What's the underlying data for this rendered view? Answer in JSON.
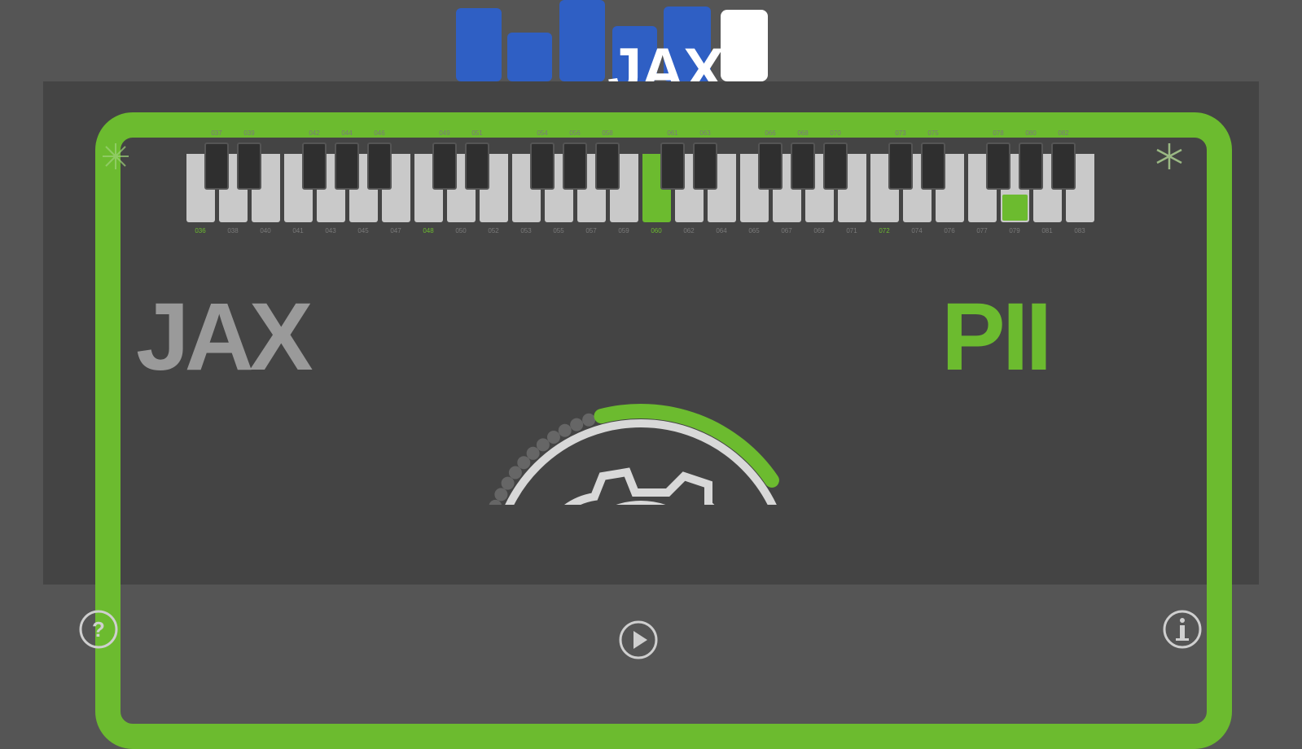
{
  "app": {
    "logo_text": "JAX",
    "brand_left": "JAX",
    "brand_right": "PII",
    "accent": "#6cbb2f",
    "logo_blue": "#2f5fc4"
  },
  "keyboard": {
    "white_labels": [
      "036",
      "038",
      "040",
      "041",
      "043",
      "045",
      "047",
      "048",
      "050",
      "052",
      "053",
      "055",
      "057",
      "059",
      "060",
      "062",
      "064",
      "065",
      "067",
      "069",
      "071",
      "072",
      "074",
      "076",
      "077",
      "079",
      "081",
      "083"
    ],
    "black_labels_top": [
      "037",
      "039",
      "042",
      "044",
      "046",
      "049",
      "051",
      "054",
      "056",
      "058",
      "061",
      "063",
      "066",
      "068",
      "070",
      "073",
      "075",
      "078",
      "080",
      "082"
    ],
    "active_white_key": "060",
    "highlighted_white_key": "079",
    "green_labels": [
      "036",
      "048",
      "060",
      "072"
    ]
  },
  "dial": {
    "level": 0.42
  },
  "toolbar": {
    "help_icon": "question-circle-icon",
    "play_icon": "play-circle-icon",
    "info_icon": "info-circle-icon"
  }
}
